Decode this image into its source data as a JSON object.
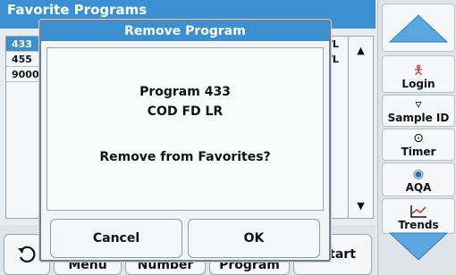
{
  "screen": {
    "title": "Favorite Programs",
    "rows": [
      {
        "number": "433",
        "selected": true
      },
      {
        "number": "455",
        "selected": false
      },
      {
        "number": "9000",
        "selected": false
      }
    ],
    "units": [
      "g/L",
      "g/L"
    ],
    "bottom_buttons": [
      "Menu",
      "Number",
      "Program",
      "Start"
    ]
  },
  "sidebar": {
    "items": [
      {
        "label": "Login",
        "icon": "person-icon"
      },
      {
        "label": "Sample ID",
        "icon": "sample-icon"
      },
      {
        "label": "Timer",
        "icon": "timer-icon"
      },
      {
        "label": "AQA",
        "icon": "aqa-icon"
      },
      {
        "label": "Trends",
        "icon": "trends-icon"
      }
    ]
  },
  "dialog": {
    "title": "Remove Program",
    "program": "Program 433",
    "program_name": "COD FD LR",
    "question": "Remove from Favorites?",
    "cancel_label": "Cancel",
    "ok_label": "OK"
  },
  "colors": {
    "accent": "#3c8fd0",
    "arrow": "#5aa7e0"
  }
}
